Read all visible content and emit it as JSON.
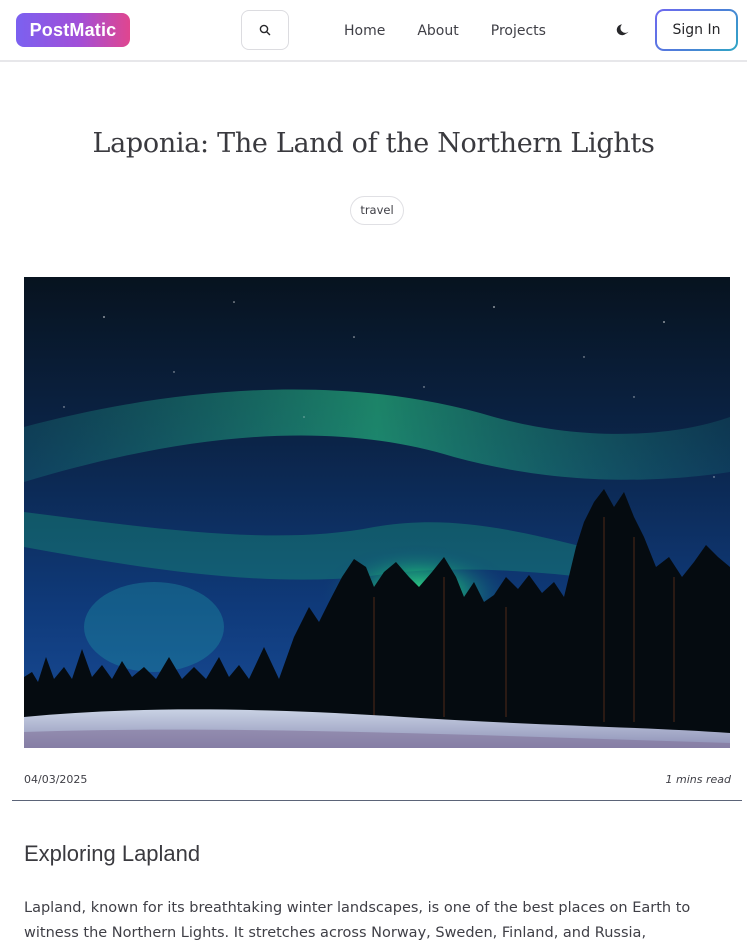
{
  "header": {
    "logo_text": "PostMatic",
    "nav": [
      "Home",
      "About",
      "Projects"
    ],
    "signin_label": "Sign In",
    "icons": {
      "search": "search-icon",
      "theme": "moon-icon"
    }
  },
  "post": {
    "title": "Laponia: The Land of the Northern Lights",
    "tag": "travel",
    "hero_alt": "Northern lights over a snowy pine forest",
    "date": "04/03/2025",
    "read_time": "1 mins read",
    "section_heading": "Exploring Lapland",
    "paragraph": "Lapland, known for its breathtaking winter landscapes, is one of the best places on Earth to witness the Northern Lights. It stretches across Norway, Sweden, Finland, and Russia,"
  },
  "colors": {
    "logo_gradient": [
      "#7b61f0",
      "#e0468f"
    ],
    "signin_border": [
      "#6f68f0",
      "#2ea7c4"
    ],
    "aurora": "#3cf08a",
    "sky": "#0a1d3a"
  }
}
